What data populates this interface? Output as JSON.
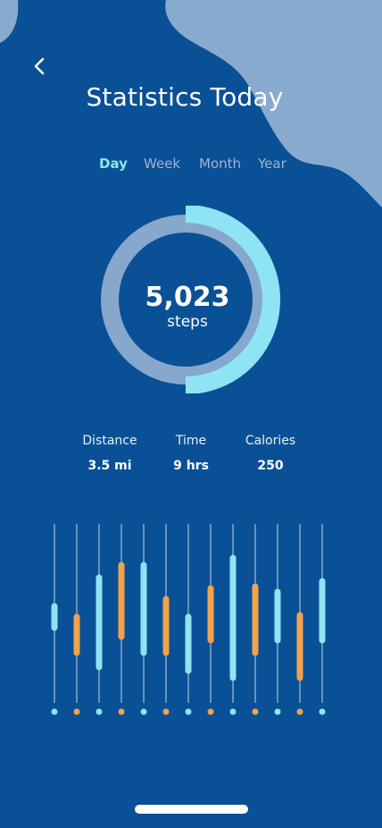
{
  "header": {
    "title": "Statistics Today",
    "back_icon": "chevron-left-icon"
  },
  "tabs": [
    {
      "label": "Day",
      "active": true
    },
    {
      "label": "Week",
      "active": false
    },
    {
      "label": "Month",
      "active": false
    },
    {
      "label": "Year",
      "active": false
    }
  ],
  "summary": {
    "steps_value": "5,023",
    "steps_unit": "steps",
    "progress_fraction": 0.5
  },
  "stats": [
    {
      "label": "Distance",
      "value": "3.5 mi"
    },
    {
      "label": "Time",
      "value": "9 hrs"
    },
    {
      "label": "Calories",
      "value": "250"
    }
  ],
  "colors": {
    "background": "#0a5096",
    "accent_cyan": "#8fe4f4",
    "accent_orange": "#f2a24a",
    "ring_track": "#87a8cc",
    "blob": "#88aacf"
  },
  "chart_data": {
    "type": "bar",
    "series_colors": [
      "cyan",
      "orange",
      "cyan",
      "orange",
      "cyan",
      "orange",
      "cyan",
      "orange",
      "cyan",
      "orange",
      "cyan",
      "orange",
      "cyan"
    ],
    "ranges": [
      [
        0.42,
        0.54
      ],
      [
        0.28,
        0.48
      ],
      [
        0.2,
        0.7
      ],
      [
        0.37,
        0.77
      ],
      [
        0.28,
        0.77
      ],
      [
        0.28,
        0.58
      ],
      [
        0.18,
        0.48
      ],
      [
        0.35,
        0.64
      ],
      [
        0.14,
        0.81
      ],
      [
        0.28,
        0.65
      ],
      [
        0.35,
        0.62
      ],
      [
        0.14,
        0.49
      ],
      [
        0.35,
        0.68
      ]
    ]
  }
}
